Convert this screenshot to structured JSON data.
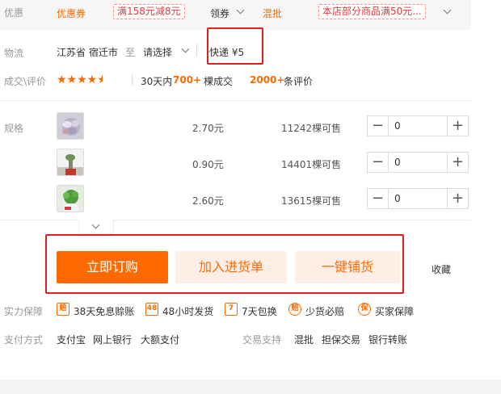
{
  "promo": {
    "label": "优惠",
    "coupon_tag": "优惠券",
    "coupon1": "满158元减8元",
    "claim": "领券",
    "mix_label": "混批",
    "mix_tag": "本店部分商品满50元..."
  },
  "logistics": {
    "label": "物流",
    "from": "江苏省 宿迁市",
    "to_word": "至",
    "dest": "请选择",
    "shipping": "快递 ¥5"
  },
  "rating": {
    "label": "成交\\评价",
    "stars": "★★★★",
    "half_star": "★",
    "deals_prefix": "30天内",
    "deals_count": "700+",
    "deals_suffix": "棵成交",
    "reviews_count": "2000+",
    "reviews_suffix": "条评价"
  },
  "spec": {
    "label": "规格",
    "rows": [
      {
        "price": "2.70元",
        "stock": "11242棵可售",
        "qty": "0"
      },
      {
        "price": "0.90元",
        "stock": "14401棵可售",
        "qty": "0"
      },
      {
        "price": "2.60元",
        "stock": "13615棵可售",
        "qty": "0"
      }
    ]
  },
  "actions": {
    "buy": "立即订购",
    "cart": "加入进货单",
    "distribute": "一键铺货",
    "favorite": "收藏"
  },
  "guarantee": {
    "label": "实力保障",
    "items": [
      {
        "icon": "赔",
        "text": "38天免息赊账"
      },
      {
        "icon": "48",
        "text": "48小时发货"
      },
      {
        "icon": "7",
        "text": "7天包换"
      },
      {
        "icon": "赔",
        "text": "少货必赔"
      },
      {
        "icon": "保",
        "text": "买家保障"
      }
    ]
  },
  "payment": {
    "label": "支付方式",
    "methods": [
      "支付宝",
      "网上银行",
      "大额支付"
    ],
    "trade_label": "交易支持",
    "trade": [
      "混批",
      "担保交易",
      "银行转账"
    ]
  },
  "colors": {
    "accent": "#ff6a00",
    "highlight_box": "#e02020",
    "soft_button": "#ffeee5"
  }
}
